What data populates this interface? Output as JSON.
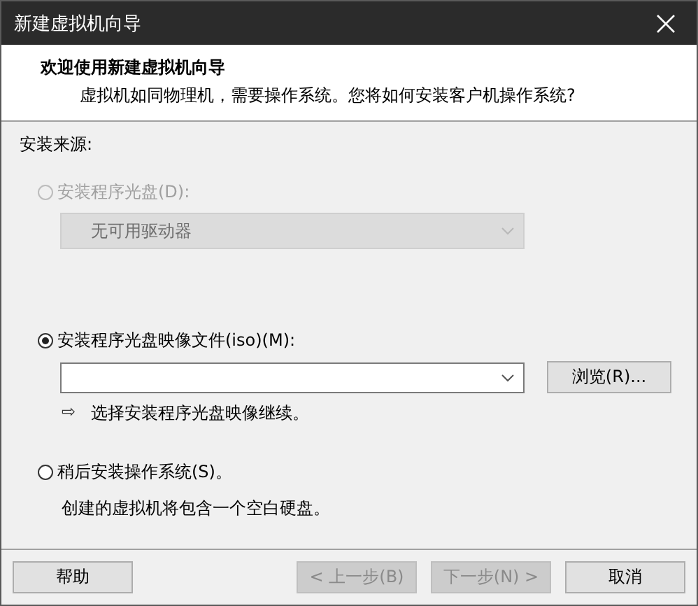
{
  "window": {
    "title": "新建虚拟机向导"
  },
  "header": {
    "title": "欢迎使用新建虚拟机向导",
    "subtitle": "虚拟机如同物理机，需要操作系统。您将如何安装客户机操作系统?"
  },
  "source_label": "安装来源:",
  "options": [
    {
      "kind": "drive",
      "label": "安装程序光盘(D):",
      "selected": false,
      "disabled": true,
      "dropdown": {
        "value": "无可用驱动器",
        "disabled": true
      }
    },
    {
      "kind": "iso",
      "label": "安装程序光盘映像文件(iso)(M):",
      "selected": true,
      "disabled": false,
      "dropdown": {
        "disabled": false
      },
      "browse_button": "浏览(R)...",
      "hint_icon": "⇨",
      "hint": "选择安装程序光盘映像继续。"
    },
    {
      "kind": "later",
      "label": "稍后安装操作系统(S)。",
      "selected": false,
      "disabled": false,
      "note": "创建的虚拟机将包含一个空白硬盘。"
    }
  ],
  "buttons": [
    {
      "kind": "help",
      "label": "帮助",
      "disabled": false
    },
    {
      "kind": "back",
      "label": "< 上一步(B)",
      "disabled": true
    },
    {
      "kind": "next",
      "label": "下一步(N) >",
      "disabled": true
    },
    {
      "kind": "cancel",
      "label": "取消",
      "disabled": false
    }
  ]
}
